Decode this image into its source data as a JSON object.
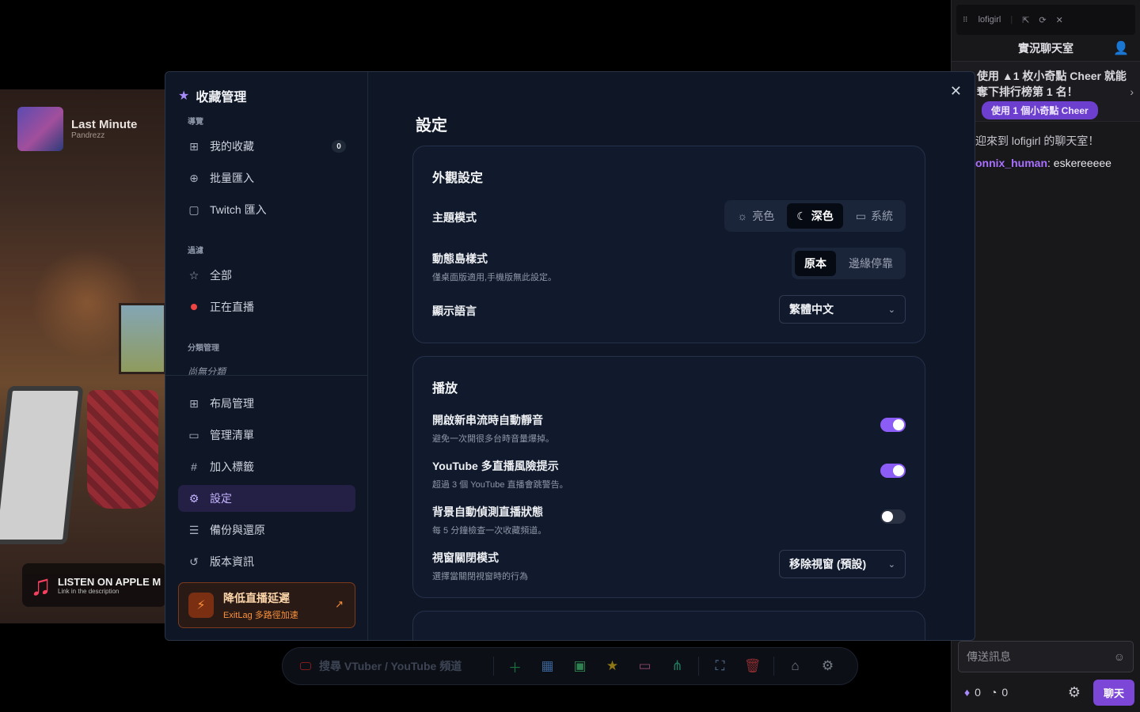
{
  "now_playing": {
    "title": "Last Minute",
    "artist": "Pandrezz"
  },
  "apple_banner": {
    "line1": "LISTEN ON APPLE M",
    "line2": "Link in the description"
  },
  "chat": {
    "channel": "lofigirl",
    "header": "實況聊天室",
    "cheer_text": "使用 ▲1 枚小奇點 Cheer 就能奪下排行榜第 1 名！",
    "cheer_button": "使用 1 個小奇點 Cheer",
    "welcome": "迎來到 lofigirl 的聊天室！",
    "message_user": "onnix_human",
    "message_text": ": eskereeeee",
    "input_placeholder": "傳送訊息",
    "points_a": "0",
    "points_b": "0",
    "send_label": "聊天"
  },
  "toolbar": {
    "search_placeholder": "搜尋 VTuber / YouTube 頻道"
  },
  "sidebar": {
    "title": "收藏管理",
    "section_browse": "導覽",
    "my_favorites": "我的收藏",
    "favorites_count": "0",
    "bulk_import": "批量匯入",
    "twitch_import": "Twitch 匯入",
    "section_filter": "過濾",
    "all": "全部",
    "live": "正在直播",
    "section_category": "分類管理",
    "no_category": "尚無分類",
    "layout": "布局管理",
    "manage_list": "管理清單",
    "add_tag": "加入標籤",
    "settings": "設定",
    "backup": "備份與還原",
    "version": "版本資訊",
    "promo_title": "降低直播延遲",
    "promo_sub": "ExitLag 多路徑加速"
  },
  "settings": {
    "title": "設定",
    "appearance": {
      "heading": "外觀設定",
      "theme_label": "主題模式",
      "theme_options": [
        "亮色",
        "深色",
        "系統"
      ],
      "theme_selected": "深色",
      "island_label": "動態島樣式",
      "island_desc": "僅桌面版適用,手機版無此設定。",
      "island_options": [
        "原本",
        "邊緣停靠"
      ],
      "island_selected": "原本",
      "language_label": "顯示語言",
      "language_value": "繁體中文"
    },
    "playback": {
      "heading": "播放",
      "automute_label": "開啟新串流時自動靜音",
      "automute_desc": "避免一次開很多台時音量爆掉。",
      "automute_on": true,
      "yt_warn_label": "YouTube 多直播風險提示",
      "yt_warn_desc": "超過 3 個 YouTube 直播會跳警告。",
      "yt_warn_on": true,
      "bg_detect_label": "背景自動偵測直播狀態",
      "bg_detect_desc": "每 5 分鐘檢查一次收藏頻道。",
      "bg_detect_on": false,
      "close_mode_label": "視窗關閉模式",
      "close_mode_desc": "選擇當關閉視窗時的行為",
      "close_mode_value": "移除視窗 (預設)"
    }
  },
  "colors": {
    "accent": "#8b5cf6",
    "live": "#ef4444",
    "promo": "#fb923c"
  }
}
